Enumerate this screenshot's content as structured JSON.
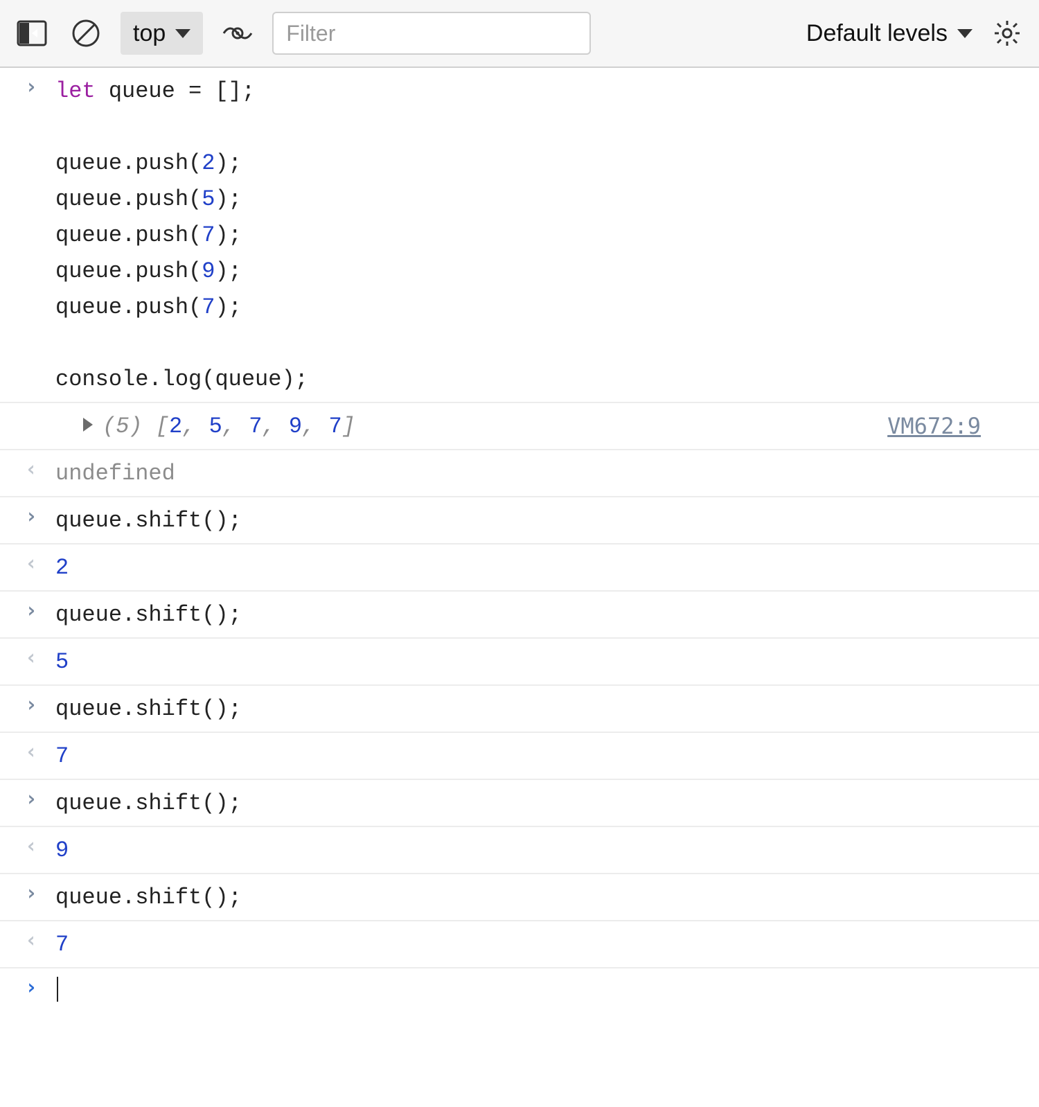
{
  "toolbar": {
    "context": "top",
    "filter_placeholder": "Filter",
    "levels_label": "Default levels"
  },
  "entries": [
    {
      "type": "input",
      "tokens": [
        {
          "t": "let",
          "c": "kw"
        },
        {
          "t": " queue = [];\n\nqueue.",
          "c": "dark"
        },
        {
          "t": "push",
          "c": "dark"
        },
        {
          "t": "(",
          "c": "dark"
        },
        {
          "t": "2",
          "c": "num"
        },
        {
          "t": ");\nqueue.push(",
          "c": "dark"
        },
        {
          "t": "5",
          "c": "num"
        },
        {
          "t": ");\nqueue.push(",
          "c": "dark"
        },
        {
          "t": "7",
          "c": "num"
        },
        {
          "t": ");\nqueue.push(",
          "c": "dark"
        },
        {
          "t": "9",
          "c": "num"
        },
        {
          "t": ");\nqueue.push(",
          "c": "dark"
        },
        {
          "t": "7",
          "c": "num"
        },
        {
          "t": ");\n\nconsole.log(queue);",
          "c": "dark"
        }
      ]
    },
    {
      "type": "log",
      "source": "VM672:9",
      "tokens": [
        {
          "t": "(5)",
          "c": "gray-ital"
        },
        {
          "t": " ",
          "c": "gray-ital"
        },
        {
          "t": "[",
          "c": "gray-ital"
        },
        {
          "t": "2",
          "c": "num"
        },
        {
          "t": ", ",
          "c": "gray-ital"
        },
        {
          "t": "5",
          "c": "num"
        },
        {
          "t": ", ",
          "c": "gray-ital"
        },
        {
          "t": "7",
          "c": "num"
        },
        {
          "t": ", ",
          "c": "gray-ital"
        },
        {
          "t": "9",
          "c": "num"
        },
        {
          "t": ", ",
          "c": "gray-ital"
        },
        {
          "t": "7",
          "c": "num"
        },
        {
          "t": "]",
          "c": "gray-ital"
        }
      ]
    },
    {
      "type": "result",
      "tokens": [
        {
          "t": "undefined",
          "c": "gray"
        }
      ]
    },
    {
      "type": "input",
      "tokens": [
        {
          "t": "queue.shift();",
          "c": "dark"
        }
      ]
    },
    {
      "type": "result",
      "tokens": [
        {
          "t": "2",
          "c": "num"
        }
      ]
    },
    {
      "type": "input",
      "tokens": [
        {
          "t": "queue.shift();",
          "c": "dark"
        }
      ]
    },
    {
      "type": "result",
      "tokens": [
        {
          "t": "5",
          "c": "num"
        }
      ]
    },
    {
      "type": "input",
      "tokens": [
        {
          "t": "queue.shift();",
          "c": "dark"
        }
      ]
    },
    {
      "type": "result",
      "tokens": [
        {
          "t": "7",
          "c": "num"
        }
      ]
    },
    {
      "type": "input",
      "tokens": [
        {
          "t": "queue.shift();",
          "c": "dark"
        }
      ]
    },
    {
      "type": "result",
      "tokens": [
        {
          "t": "9",
          "c": "num"
        }
      ]
    },
    {
      "type": "input",
      "tokens": [
        {
          "t": "queue.shift();",
          "c": "dark"
        }
      ]
    },
    {
      "type": "result",
      "tokens": [
        {
          "t": "7",
          "c": "num"
        }
      ]
    }
  ]
}
